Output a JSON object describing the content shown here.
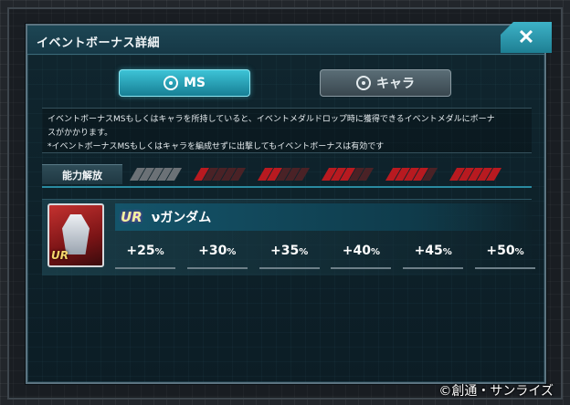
{
  "dialog": {
    "title": "イベントボーナス詳細",
    "close_label": "✕"
  },
  "tabs": [
    {
      "label": "MS",
      "active": true
    },
    {
      "label": "キャラ",
      "active": false
    }
  ],
  "description": {
    "line1": "イベントボーナスMSもしくはキャラを所持していると、イベントメダルドロップ時に獲得できるイベントメダルにボーナ",
    "line2": "スがかかります。",
    "line3": "*イベントボーナスMSもしくはキャラを編成せずに出撃してもイベントボーナスは有効です"
  },
  "ability": {
    "label": "能力解放",
    "levels": [
      {
        "red": 0
      },
      {
        "red": 1
      },
      {
        "red": 2
      },
      {
        "red": 3
      },
      {
        "red": 4
      },
      {
        "red": 5
      }
    ]
  },
  "unit": {
    "rarity": "UR",
    "name": "νガンダム",
    "bonuses": [
      {
        "num": "+25",
        "unit": "%"
      },
      {
        "num": "+30",
        "unit": "%"
      },
      {
        "num": "+35",
        "unit": "%"
      },
      {
        "num": "+40",
        "unit": "%"
      },
      {
        "num": "+45",
        "unit": "%"
      },
      {
        "num": "+50",
        "unit": "%"
      }
    ]
  },
  "copyright": "©創通・サンライズ",
  "colors": {
    "accent": "#3dc3d6",
    "panel": "#10262f",
    "slash_active": "#b81a20",
    "slash_inactive": "#6b7176"
  }
}
